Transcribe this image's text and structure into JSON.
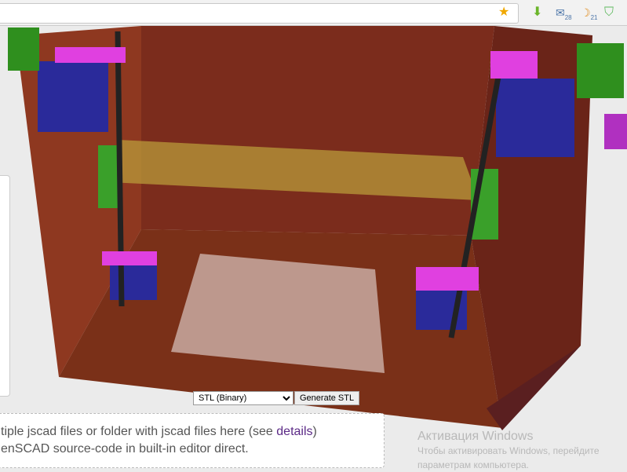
{
  "toolbar": {
    "icons": [
      "bookmark-star-icon",
      "download-icon",
      "mail-icon",
      "calendar-icon",
      "shield-icon"
    ],
    "mail_badge": "28",
    "calendar_badge": "21"
  },
  "controls": {
    "format_selected": "STL (Binary)",
    "generate_label": "Generate STL"
  },
  "dropzone": {
    "line1_prefix": "tiple jscad files or folder with jscad files here (see ",
    "details_link": "details",
    "line1_suffix": ")",
    "line2": "enSCAD source-code in built-in editor direct."
  },
  "windows_activation": {
    "title": "Активация Windows",
    "line1": "Чтобы активировать Windows, перейдите",
    "line2": "параметрам компьютера."
  }
}
